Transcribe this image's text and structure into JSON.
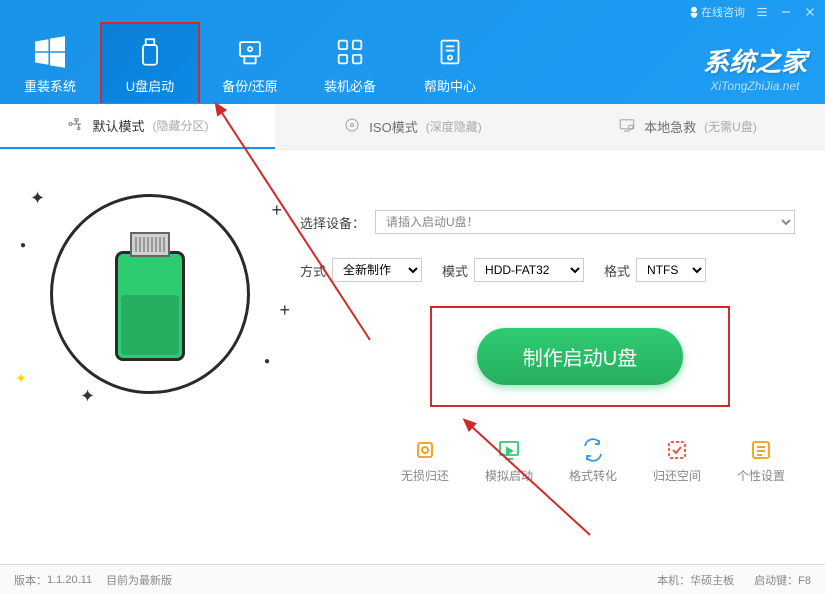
{
  "titlebar": {
    "consult": "在线咨询"
  },
  "nav": {
    "items": [
      {
        "label": "重装系统"
      },
      {
        "label": "U盘启动"
      },
      {
        "label": "备份/还原"
      },
      {
        "label": "装机必备"
      },
      {
        "label": "帮助中心"
      }
    ]
  },
  "brand": {
    "title": "系统之家",
    "subtitle": "XiTongZhiJia.net"
  },
  "mode_tabs": {
    "default": {
      "label": "默认模式",
      "sub": "(隐藏分区)"
    },
    "iso": {
      "label": "ISO模式",
      "sub": "(深度隐藏)"
    },
    "local": {
      "label": "本地急救",
      "sub": "(无需U盘)"
    }
  },
  "form": {
    "device_label": "选择设备：",
    "device_value": "请插入启动U盘！",
    "method_label": "方式",
    "method_value": "全新制作",
    "mode_label": "模式",
    "mode_value": "HDD-FAT32",
    "format_label": "格式",
    "format_value": "NTFS"
  },
  "action": {
    "button": "制作启动U盘"
  },
  "tools": {
    "items": [
      {
        "label": "无损归还"
      },
      {
        "label": "模拟启动"
      },
      {
        "label": "格式转化"
      },
      {
        "label": "归还空间"
      },
      {
        "label": "个性设置"
      }
    ]
  },
  "status": {
    "version_label": "版本：",
    "version": "1.1.20.11",
    "latest": "目前为最新版",
    "machine_label": "本机：",
    "machine": "华硕主板",
    "bootkey_label": "启动键：",
    "bootkey": "F8"
  }
}
